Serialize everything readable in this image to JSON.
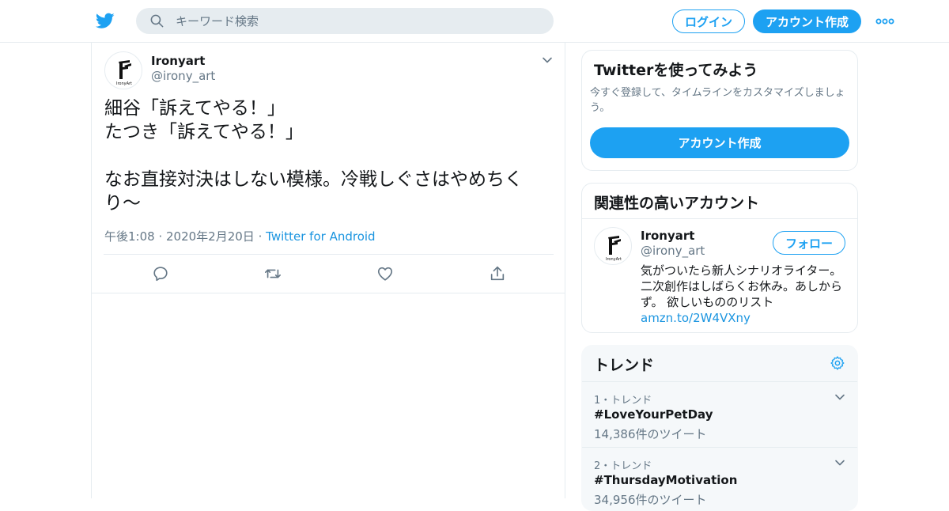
{
  "header": {
    "search_placeholder": "キーワード検索",
    "login_label": "ログイン",
    "signup_label": "アカウント作成",
    "brand_color": "#1da1f2",
    "icons": [
      "twitter-bird-icon",
      "search-icon",
      "more-dots-icon"
    ]
  },
  "tweet": {
    "user_name": "Ironyart",
    "user_handle": "@irony_art",
    "avatar_text": "IronyArt",
    "text": "細谷「訴えてやる！」\nたつき「訴えてやる！」\n\nなお直接対決はしない模様。冷戦しぐさはやめちくり〜",
    "timestamp": "午後1:08 · 2020年2月20日",
    "separator": "·",
    "source": "Twitter for Android",
    "action_icons": [
      "reply-icon",
      "retweet-icon",
      "like-icon",
      "share-icon"
    ]
  },
  "sidebar": {
    "signup_card": {
      "title": "Twitterを使ってみよう",
      "description": "今すぐ登録して、タイムラインをカスタマイズしましょう。",
      "button_label": "アカウント作成"
    },
    "related_card": {
      "title": "関連性の高いアカウント",
      "account": {
        "name": "Ironyart",
        "handle": "@irony_art",
        "follow_label": "フォロー",
        "bio": "気がついたら新人シナリオライター。二次創作はしばらくお休み。あしからず。 欲しいもののリスト",
        "bio_link": "amzn.to/2W4VXny"
      }
    },
    "trends_card": {
      "title": "トレンド",
      "items": [
        {
          "meta": "1・トレンド",
          "name": "#LoveYourPetDay",
          "count": "14,386件のツイート"
        },
        {
          "meta": "2・トレンド",
          "name": "#ThursdayMotivation",
          "count": "34,956件のツイート"
        }
      ]
    }
  }
}
